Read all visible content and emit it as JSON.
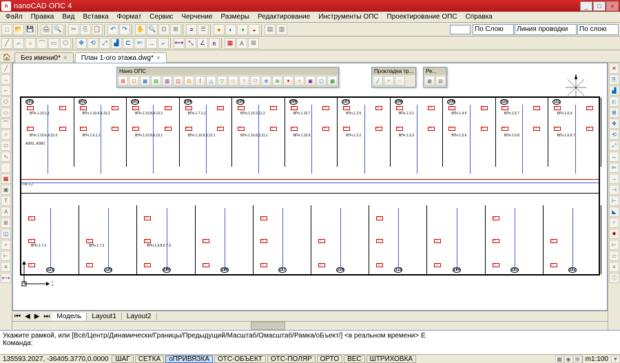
{
  "app": {
    "title": "nanoCAD ОПС 4"
  },
  "menu": [
    "Файл",
    "Правка",
    "Вид",
    "Вставка",
    "Формат",
    "Сервис",
    "Черчение",
    "Размеры",
    "Редактирование",
    "Инструменты ОПС",
    "Проектирование ОПС",
    "Справка"
  ],
  "tabs": {
    "items": [
      {
        "label": "Без имени0*",
        "active": false
      },
      {
        "label": "План 1-ого этажа.dwg*",
        "active": true
      }
    ]
  },
  "props": {
    "layer_combo": "По Слою",
    "linetype": "Линия проводки",
    "lineweight": "По слою"
  },
  "float_toolbars": {
    "main": {
      "title": "Нано ОПС"
    },
    "route": {
      "title": "Прокладка тр..."
    },
    "re": {
      "title": "Ре..."
    }
  },
  "plan": {
    "rooms_top": [
      "101",
      "102",
      "103",
      "104",
      "105",
      "106",
      "107",
      "108",
      "109",
      "110",
      "111"
    ],
    "rooms_bot": [
      "121",
      "120",
      "119",
      "118",
      "117",
      "116",
      "115",
      "114",
      "113",
      "112"
    ],
    "sample_labels": [
      "ВПч.1.10.1,1",
      "ВПч.1.10.6,4,15.3",
      "ВПч.1.10.6,4,15.2",
      "ВПч.1.9.1,1",
      "ВПч.1.10.8,4,13.2",
      "ВПч.1.10.8,4,13.1",
      "ВПч.1.7.1,1",
      "ВПч.1.10.8,3,12.1",
      "ВПч.1.10.3,11.2",
      "ВПч.1.10.8,3,11.1",
      "ВПч.1.10.7",
      "ВПч.1.10.9",
      "ВПч.1.2.5",
      "ВПч.1.3.2",
      "ВПч.1.3.1",
      "ВПч.1.3.3",
      "ВПч.1.4.5",
      "ВПч.1.5.6",
      "ВПч.1.6.7",
      "ВПч.1.6.8",
      "ВПч.1.6.9",
      "ВПч.1.6.8.7",
      "ВПч.1.7.1",
      "ВПч.1.7.3",
      "ВПч.1.6.8.6.7.3"
    ],
    "pk_label": "ПК 1.2",
    "azi": "АЗИ1, АЗИ2"
  },
  "model_tabs": [
    "Модель",
    "Layout1",
    "Layout2"
  ],
  "cmd": {
    "line1": "Укажите рамкой, или [Всё/Центр/Динамически/Границы/Предыдущий/Масштаб/Омасштаб/Рамка/оБъект/] <в реальном времени> Е",
    "prompt": "Команда:"
  },
  "status": {
    "coords": "135593.2027, -36405.3770,0.0000",
    "buttons": [
      "ШАГ",
      "СЕТКА",
      "оПРИВЯЗКА",
      "ОТС-ОБЪЕКТ",
      "ОТС-ПОЛЯР",
      "ОРТО",
      "ВЕС",
      "ШТРИХОВКА"
    ],
    "active_idx": 2,
    "scale": "m1:100"
  }
}
